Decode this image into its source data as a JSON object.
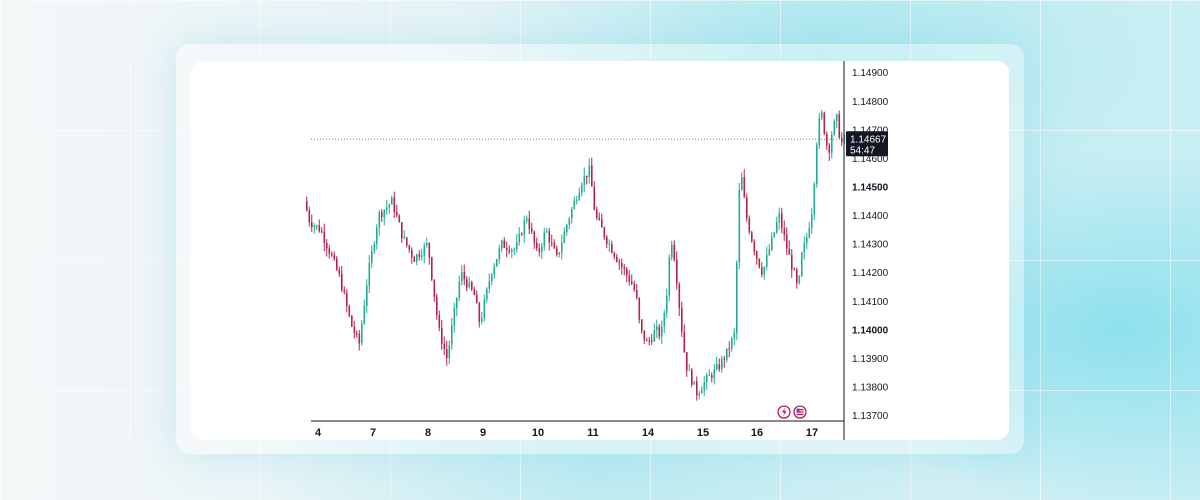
{
  "chart_data": {
    "type": "candlestick",
    "grid": false,
    "colors": {
      "up": "#22ab94",
      "down": "#b2224a",
      "axis": "#131722",
      "last_price_line": "#787b86"
    },
    "x_ticks": [
      "4",
      "7",
      "8",
      "9",
      "10",
      "11",
      "14",
      "15",
      "16",
      "17"
    ],
    "y_ticks": [
      {
        "label": "1.14900",
        "value": 1.149,
        "bold": false
      },
      {
        "label": "1.14800",
        "value": 1.148,
        "bold": false
      },
      {
        "label": "1.14700",
        "value": 1.147,
        "bold": false
      },
      {
        "label": "1.14600",
        "value": 1.146,
        "bold": false
      },
      {
        "label": "1.14500",
        "value": 1.145,
        "bold": true
      },
      {
        "label": "1.14400",
        "value": 1.144,
        "bold": false
      },
      {
        "label": "1.14300",
        "value": 1.143,
        "bold": false
      },
      {
        "label": "1.14200",
        "value": 1.142,
        "bold": false
      },
      {
        "label": "1.14100",
        "value": 1.141,
        "bold": false
      },
      {
        "label": "1.14000",
        "value": 1.14,
        "bold": true
      },
      {
        "label": "1.13900",
        "value": 1.139,
        "bold": false
      },
      {
        "label": "1.13800",
        "value": 1.138,
        "bold": false
      },
      {
        "label": "1.13700",
        "value": 1.137,
        "bold": false
      }
    ],
    "ylim": [
      1.1366,
      1.1492
    ],
    "last_price": {
      "value": 1.14667,
      "label": "1.14667",
      "countdown": "54:47"
    },
    "price_path": [
      [
        4.0,
        1.1445
      ],
      [
        4.1,
        1.1438
      ],
      [
        4.3,
        1.1435
      ],
      [
        4.45,
        1.1428
      ],
      [
        4.65,
        1.1418
      ],
      [
        4.85,
        1.1402
      ],
      [
        5.0,
        1.1395
      ],
      [
        5.15,
        1.1418
      ],
      [
        5.35,
        1.144
      ],
      [
        5.6,
        1.1445
      ],
      [
        5.8,
        1.1432
      ],
      [
        6.0,
        1.1425
      ],
      [
        6.25,
        1.143
      ],
      [
        6.45,
        1.14
      ],
      [
        6.6,
        1.139
      ],
      [
        6.85,
        1.142
      ],
      [
        7.1,
        1.1412
      ],
      [
        7.2,
        1.1402
      ],
      [
        7.4,
        1.142
      ],
      [
        7.6,
        1.143
      ],
      [
        7.85,
        1.1428
      ],
      [
        8.05,
        1.144
      ],
      [
        8.25,
        1.1426
      ],
      [
        8.4,
        1.1435
      ],
      [
        8.6,
        1.1425
      ],
      [
        8.8,
        1.1438
      ],
      [
        9.05,
        1.1452
      ],
      [
        9.2,
        1.1456
      ],
      [
        9.3,
        1.144
      ],
      [
        9.5,
        1.1432
      ],
      [
        9.7,
        1.1425
      ],
      [
        9.85,
        1.142
      ],
      [
        10.0,
        1.1415
      ],
      [
        10.06,
        1.141
      ],
      [
        10.12,
        1.14
      ],
      [
        10.25,
        1.1395
      ],
      [
        10.4,
        1.14
      ],
      [
        10.5,
        1.1398
      ],
      [
        10.6,
        1.1412
      ],
      [
        10.68,
        1.1433
      ],
      [
        10.75,
        1.1425
      ],
      [
        10.85,
        1.1405
      ],
      [
        10.95,
        1.1388
      ],
      [
        11.15,
        1.1378
      ],
      [
        11.35,
        1.1383
      ],
      [
        11.55,
        1.1387
      ],
      [
        11.7,
        1.1392
      ],
      [
        11.85,
        1.1399
      ],
      [
        11.9,
        1.144
      ],
      [
        11.95,
        1.1456
      ],
      [
        12.05,
        1.144
      ],
      [
        12.15,
        1.1432
      ],
      [
        12.25,
        1.1425
      ],
      [
        12.35,
        1.142
      ],
      [
        12.5,
        1.143
      ],
      [
        12.65,
        1.144
      ],
      [
        12.8,
        1.1428
      ],
      [
        12.92,
        1.142
      ],
      [
        13.0,
        1.1413
      ],
      [
        13.05,
        1.1425
      ],
      [
        13.15,
        1.1432
      ],
      [
        13.25,
        1.1442
      ],
      [
        13.3,
        1.1455
      ],
      [
        13.35,
        1.147
      ],
      [
        13.42,
        1.1476
      ],
      [
        13.5,
        1.1467
      ],
      [
        13.55,
        1.1462
      ],
      [
        13.62,
        1.147
      ],
      [
        13.7,
        1.1474
      ],
      [
        13.78,
        1.1465
      ],
      [
        13.85,
        1.1467
      ]
    ]
  }
}
